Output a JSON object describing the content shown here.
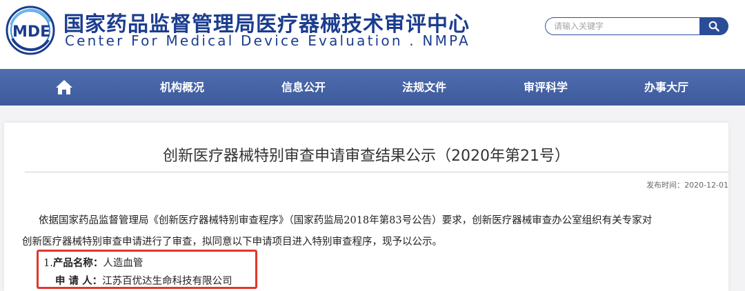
{
  "header": {
    "logo_text": "MDE",
    "title_cn": "国家药品监督管理局医疗器械技术审评中心",
    "title_en": "Center For Medical Device Evaluation . NMPA",
    "search": {
      "placeholder": "请输入关键字",
      "button_icon": "search-icon"
    }
  },
  "nav": {
    "home_icon": "home-icon",
    "items": [
      "机构概况",
      "信息公开",
      "法规文件",
      "审评科学",
      "办事大厅"
    ]
  },
  "article": {
    "title": "创新医疗器械特别审查申请审查结果公示（2020年第21号）",
    "publish_label": "发布时间：",
    "publish_date": "2020-12-01",
    "paragraph_line1": "依据国家药品监督管理局《创新医疗器械特别审查程序》（国家药监局2018年第83号公告）要求，创新医疗器械审查办公室组织有关专家对",
    "paragraph_line2": "创新医疗器械特别审查申请进行了审查，拟同意以下申请项目进入特别审查程序，现予以公示。",
    "item": {
      "number": "1.",
      "product_label": "产品名称：",
      "product_value": "人造血管",
      "applicant_label": "申 请 人：",
      "applicant_value": "江苏百优达生命科技有限公司"
    }
  },
  "colors": {
    "brand_blue": "#1b3d8f",
    "nav_blue": "#4a67a8",
    "highlight_red": "#e0362b"
  }
}
